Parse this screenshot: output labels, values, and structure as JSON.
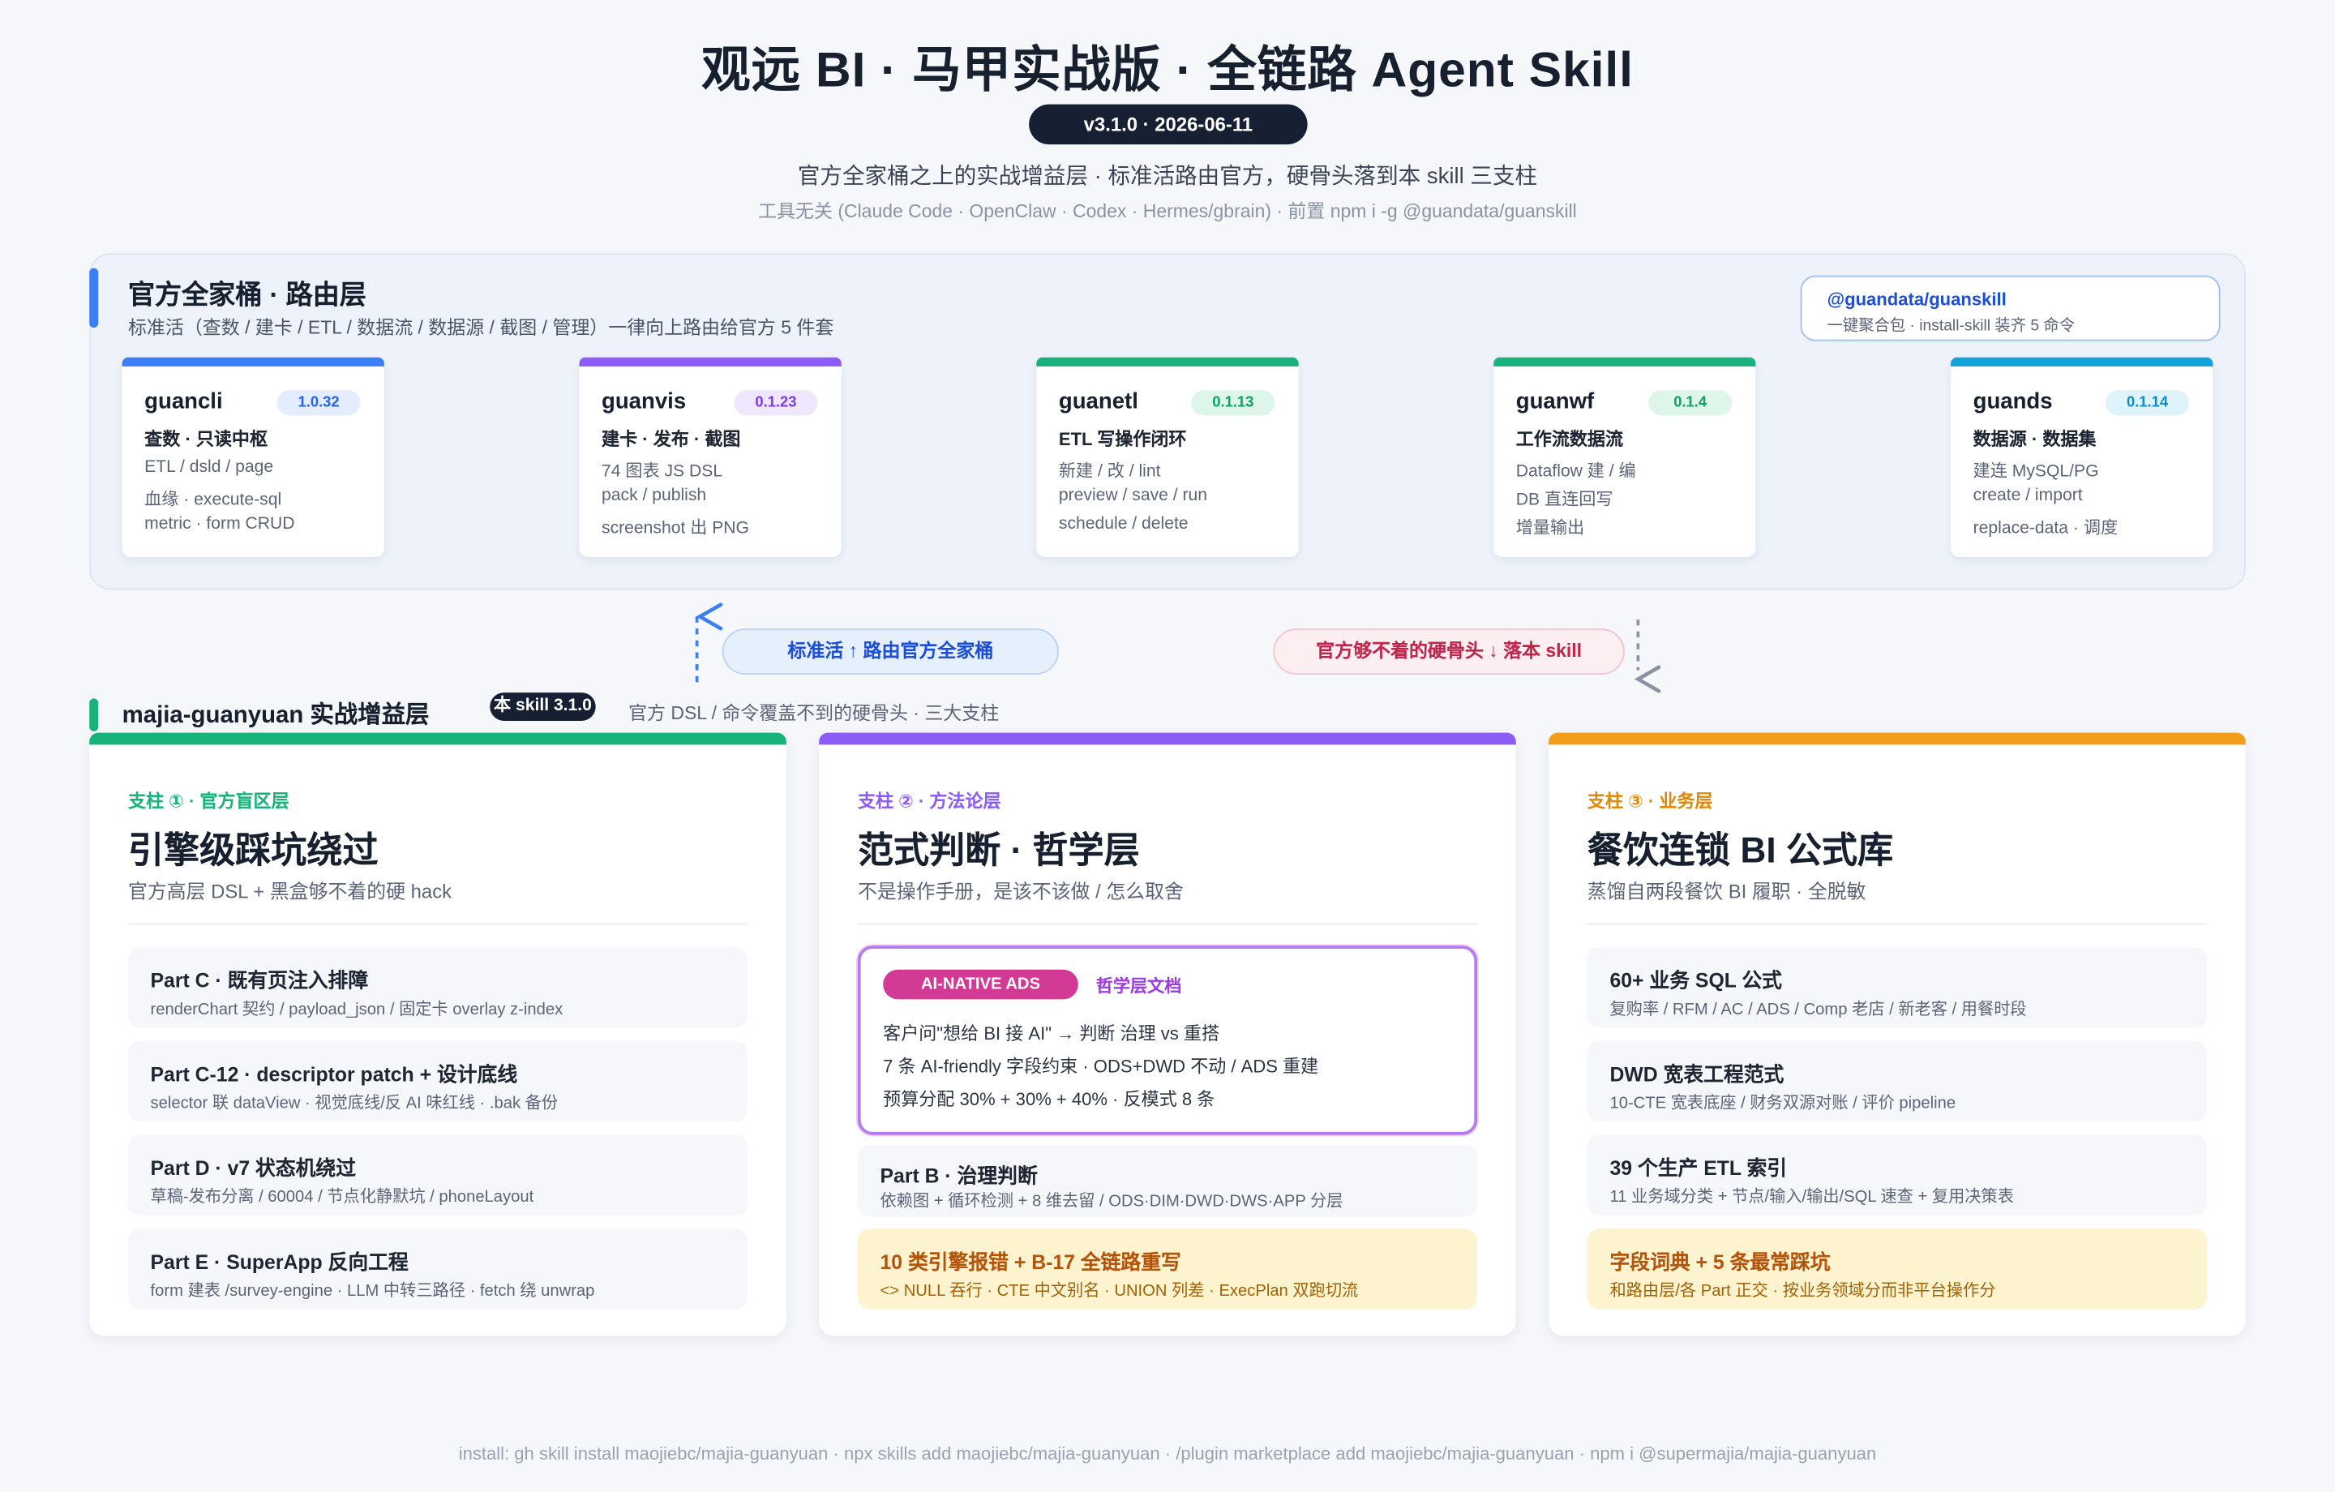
{
  "header": {
    "title": "观远 BI · 马甲实战版 · 全链路 Agent Skill",
    "version": "v3.1.0 · 2026-06-11",
    "subtitle": "官方全家桶之上的实战增益层 · 标准活路由官方，硬骨头落到本 skill 三支柱",
    "note": "工具无关 (Claude Code · OpenClaw · Codex · Hermes/gbrain) · 前置 npm i -g @guandata/guanskill"
  },
  "routing": {
    "title": "官方全家桶 · 路由层",
    "subtitle": "标准活（查数 / 建卡 / ETL / 数据流 / 数据源 / 截图 / 管理）一律向上路由给官方 5 件套",
    "bundle": {
      "name": "@guandata/guanskill",
      "desc": "一键聚合包 · install-skill 装齐 5 命令"
    },
    "packages": [
      {
        "name": "guancli",
        "version": "1.0.32",
        "role": "查数 · 只读中枢",
        "lines": [
          "ETL / dsld / page",
          "血缘 · execute-sql",
          "metric · form CRUD"
        ],
        "color": "#3b7ef5",
        "badge_bg": "#e3edfd",
        "badge_fg": "#2563eb"
      },
      {
        "name": "guanvis",
        "version": "0.1.23",
        "role": "建卡 · 发布 · 截图",
        "lines": [
          "74 图表 JS DSL",
          "pack / publish",
          "screenshot 出 PNG"
        ],
        "color": "#8b5cf6",
        "badge_bg": "#efe7fd",
        "badge_fg": "#7c3aed"
      },
      {
        "name": "guanetl",
        "version": "0.1.13",
        "role": "ETL 写操作闭环",
        "lines": [
          "新建 / 改 / lint",
          "preview / save / run",
          "schedule / delete"
        ],
        "color": "#17b37a",
        "badge_bg": "#def6ea",
        "badge_fg": "#0f9f69"
      },
      {
        "name": "guanwf",
        "version": "0.1.4",
        "role": "工作流数据流",
        "lines": [
          "Dataflow 建 / 编",
          "DB 直连回写",
          "增量输出"
        ],
        "color": "#17b37a",
        "badge_bg": "#def6ea",
        "badge_fg": "#0f9f69"
      },
      {
        "name": "guands",
        "version": "0.1.14",
        "role": "数据源 · 数据集",
        "lines": [
          "建连 MySQL/PG",
          "create / import",
          "replace-data · 调度"
        ],
        "color": "#13a3dc",
        "badge_bg": "#dff3fb",
        "badge_fg": "#0e8cc2"
      }
    ]
  },
  "routes": {
    "up": "标准活 ↑ 路由官方全家桶",
    "down": "官方够不着的硬骨头 ↓ 落本 skill"
  },
  "skill": {
    "title": "majia-guanyuan 实战增益层",
    "badge": "本 skill 3.1.0",
    "subtitle": "官方 DSL / 命令覆盖不到的硬骨头 · 三大支柱"
  },
  "pillars": [
    {
      "label": "支柱 ① · 官方盲区层",
      "title": "引擎级踩坑绕过",
      "subtitle": "官方高层 DSL + 黑盒够不着的硬 hack",
      "color": "#17b37a",
      "label_color": "#17b37a",
      "items": [
        {
          "t": "Part C · 既有页注入排障",
          "d": "renderChart 契约 / payload_json / 固定卡 overlay z-index"
        },
        {
          "t": "Part C-12 · descriptor patch + 设计底线",
          "d": "selector 联 dataView · 视觉底线/反 AI 味红线 · .bak 备份"
        },
        {
          "t": "Part D · v7 状态机绕过",
          "d": "草稿-发布分离 / 60004 / 节点化静默坑 / phoneLayout"
        },
        {
          "t": "Part E · SuperApp 反向工程",
          "d": "form 建表 /survey-engine · LLM 中转三路径 · fetch 绕 unwrap"
        }
      ]
    },
    {
      "label": "支柱 ② · 方法论层",
      "title": "范式判断 · 哲学层",
      "subtitle": "不是操作手册，是该不该做 / 怎么取舍",
      "color": "#8b5cf6",
      "label_color": "#8b5cf6",
      "ads": {
        "tag": "AI-NATIVE ADS",
        "tag2": "哲学层文档",
        "lines": [
          "客户问\"想给 BI 接 AI\" → 判断 治理 vs 重搭",
          "7 条 AI-friendly 字段约束 · ODS+DWD 不动 / ADS 重建",
          "预算分配 30% + 30% + 40% · 反模式 8 条"
        ]
      },
      "items": [
        {
          "t": "Part B · 治理判断",
          "d": "依赖图 + 循环检测 + 8 维去留 / ODS·DIM·DWD·DWS·APP 分层"
        },
        {
          "t": "10 类引擎报错 + B-17 全链路重写",
          "d": "<> NULL 吞行 · CTE 中文别名 · UNION 列差 · ExecPlan 双跑切流",
          "highlight": true
        }
      ]
    },
    {
      "label": "支柱 ③ · 业务层",
      "title": "餐饮连锁 BI 公式库",
      "subtitle": "蒸馏自两段餐饮 BI 履职 · 全脱敏",
      "color": "#f29d1a",
      "label_color": "#e08a0b",
      "items": [
        {
          "t": "60+ 业务 SQL 公式",
          "d": "复购率 / RFM / AC / ADS / Comp 老店 / 新老客 / 用餐时段"
        },
        {
          "t": "DWD 宽表工程范式",
          "d": "10-CTE 宽表底座 / 财务双源对账 / 评价 pipeline"
        },
        {
          "t": "39 个生产 ETL 索引",
          "d": "11 业务域分类 + 节点/输入/输出/SQL 速查 + 复用决策表"
        },
        {
          "t": "字段词典 + 5 条最常踩坑",
          "d": "和路由层/各 Part 正交 · 按业务领域分而非平台操作分",
          "highlight": true
        }
      ]
    }
  ],
  "footer": "install: gh skill install maojiebc/majia-guanyuan · npx skills add maojiebc/majia-guanyuan · /plugin marketplace add maojiebc/majia-guanyuan · npm i @supermajia/majia-guanyuan"
}
